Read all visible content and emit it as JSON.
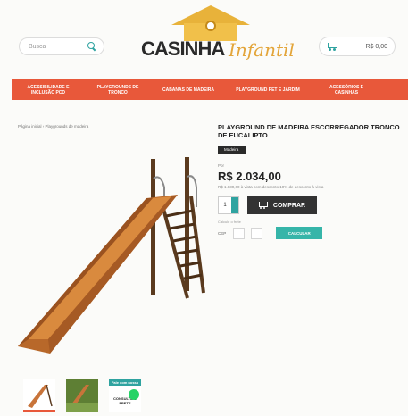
{
  "header": {
    "search_placeholder": "Busca",
    "logo_main": "CASINHA",
    "logo_script": "Infantil",
    "cart_total": "R$ 0,00"
  },
  "nav": {
    "items": [
      "Acessibilidade e Inclusão PCD",
      "Playgrounds de Tronco",
      "Cabanas de Madeira",
      "Playground Pet e Jardim",
      "Acessórios e Casinhas"
    ]
  },
  "product": {
    "breadcrumb": "Página inicial › Playgrounds de madeira",
    "title": "PLAYGROUND DE MADEIRA ESCORREGADOR TRONCO DE EUCALIPTO",
    "tag": "Madeira",
    "price_label": "Por",
    "price": "R$ 2.034,00",
    "price_alt": "R$ 1.830,60 à vista com desconto 10% de desconto à vista",
    "quantity": "1",
    "buy_label": "COMPRAR",
    "shipping_label": "Calcule o frete",
    "cep_label": "CEP",
    "calc_label": "CALCULAR"
  },
  "thumbnails": {
    "promo_text_1": "Fale com nossa",
    "promo_text_2": "CONSULTE O FRETE"
  },
  "colors": {
    "nav_bg": "#e8583a",
    "accent": "#2fa3a0",
    "calc_button": "#36b5a9",
    "buy_button": "#333333",
    "logo_script": "#e3a53a"
  }
}
